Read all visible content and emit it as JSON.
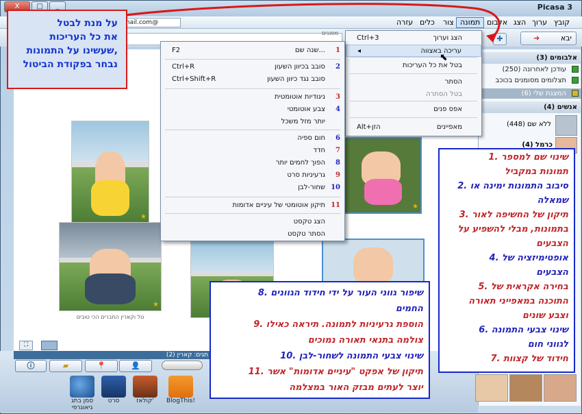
{
  "window": {
    "title": "Picasa 3",
    "controls": [
      "_",
      "□",
      "X"
    ]
  },
  "menubar": {
    "items": [
      "קובץ",
      "ערוך",
      "הצג",
      "אלבום",
      "תמונה",
      "צור",
      "כלים",
      "עזרה"
    ],
    "active_index": 4
  },
  "email": "gmail.com@",
  "toolbar": {
    "import_label": "יבא",
    "people_label": "מסננים"
  },
  "image_menu": {
    "items": [
      {
        "label": "הצג וערוך",
        "shortcut": "Ctrl+3"
      },
      {
        "label": "עריכה באצווה",
        "shortcut": "◂",
        "highlight": true
      },
      {
        "label": "בטל את כל העריכות",
        "shortcut": ""
      },
      {
        "label": "הסתר",
        "shortcut": ""
      },
      {
        "label": "בטל הסתרה",
        "shortcut": "",
        "disabled": true
      },
      {
        "label": "אפס פנים",
        "shortcut": ""
      },
      {
        "label": "מאפיינים",
        "shortcut": "Alt+הזן"
      }
    ]
  },
  "batch_menu": {
    "items": [
      {
        "num": "1",
        "label": "שנה שם...",
        "shortcut": "F2",
        "color": "#c0262a"
      },
      {
        "num": "2",
        "label": "סובב בכיוון השעון",
        "shortcut": "Ctrl+R",
        "color": "#2323b8"
      },
      {
        "num": "",
        "label": "סובב נגד כיוון השעון",
        "shortcut": "Ctrl+Shift+R",
        "color": "#2323b8"
      },
      {
        "num": "3",
        "label": "ניגודיות אוטומטית",
        "shortcut": "",
        "color": "#c0262a"
      },
      {
        "num": "4",
        "label": "צבע אוטומטי",
        "shortcut": "",
        "color": "#2323b8"
      },
      {
        "num": "",
        "label": "יותר מזל משכל",
        "shortcut": "",
        "color": "#c0262a"
      },
      {
        "num": "6",
        "label": "חום ספיה",
        "shortcut": "",
        "color": "#2323b8"
      },
      {
        "num": "7",
        "label": "חדד",
        "shortcut": "",
        "color": "#c0262a"
      },
      {
        "num": "8",
        "label": "הפוך לחמים יותר",
        "shortcut": "",
        "color": "#2323b8"
      },
      {
        "num": "9",
        "label": "גרעיניות סרט",
        "shortcut": "",
        "color": "#c0262a"
      },
      {
        "num": "10",
        "label": "שחור-לבן",
        "shortcut": "",
        "color": "#2323b8"
      },
      {
        "num": "11",
        "label": "תיקון אוטומטי של עיניים אדומות",
        "shortcut": "",
        "color": "#c0262a"
      },
      {
        "num": "",
        "label": "הצג טקסט",
        "shortcut": "",
        "color": "#c0262a"
      },
      {
        "num": "",
        "label": "הסתר טקסט",
        "shortcut": "",
        "color": "#c0262a"
      }
    ]
  },
  "note_cancel": {
    "lines": [
      "על מנת לבטל",
      "את כל העריכות",
      "שעשינו על התמונות,",
      "נבחר בפקודת הביטול"
    ]
  },
  "note_right": {
    "lines": [
      {
        "t": "1. שינוי שם למספר",
        "c": "r"
      },
      {
        "t": "תמונות במקביל",
        "c": "r"
      },
      {
        "t": "2. סיבוב התמונות ימינה או",
        "c": "b"
      },
      {
        "t": "שמאלה",
        "c": "b"
      },
      {
        "t": "3. תיקון של החשיפה לאור",
        "c": "r"
      },
      {
        "t": "בתמונות, מבלי להשפיע על",
        "c": "r"
      },
      {
        "t": "הצבעים",
        "c": "r"
      },
      {
        "t": "4. אופטימיזציה של",
        "c": "b"
      },
      {
        "t": "הצבעים",
        "c": "b"
      },
      {
        "t": "5. בחירה אקראית של",
        "c": "r"
      },
      {
        "t": "התוכנה במאפייני תאורה",
        "c": "r"
      },
      {
        "t": "וצבע שונים",
        "c": "r"
      },
      {
        "t": "6. שינוי צבעי התמונה",
        "c": "b"
      },
      {
        "t": "לגווני חום",
        "c": "b"
      },
      {
        "t": "7. חידוד של קצוות",
        "c": "r"
      }
    ]
  },
  "note_bottom": {
    "lines": [
      {
        "t": "8. שיפור גווני העור על ידי חידוד הגוונים",
        "c": "b"
      },
      {
        "t": "החמים",
        "c": "b"
      },
      {
        "t": "9. הוספת גרעיניות לתמונה. תיראה כאילו",
        "c": "r"
      },
      {
        "t": "צולמה בתנאי תאורה נמוכים",
        "c": "r"
      },
      {
        "t": "10. שינוי צבעי התמונה לשחור-לבן",
        "c": "b"
      },
      {
        "t": "11. תיקון של אפקט \"עיניים אדומות\" אשר",
        "c": "r"
      },
      {
        "t": "יוצר לעתים מבזק האור במצלמה",
        "c": "r"
      }
    ]
  },
  "sidebar": {
    "albums_header": "אלבומים (3)",
    "albums": [
      "עודכן לאחרונה (250)",
      "תצלומים מסומנים בכוכב",
      "המצגת שלי (6)"
    ],
    "people_header": "אנשים (4)",
    "people": [
      "ללא שם (448)",
      "כרמל (4)"
    ]
  },
  "photos": {
    "caption_small": "טל וקארין החברים הכי טובים"
  },
  "bottom": {
    "tags_label": "תגים: קארין (2)",
    "actions": [
      "סמן בתג גיאוגרפי",
      "סרט",
      "קולאז'",
      "BlogThis!"
    ]
  },
  "colors": {
    "annotation_red": "#c0262a",
    "annotation_blue": "#2323b8",
    "note_border_red": "#d81818"
  }
}
